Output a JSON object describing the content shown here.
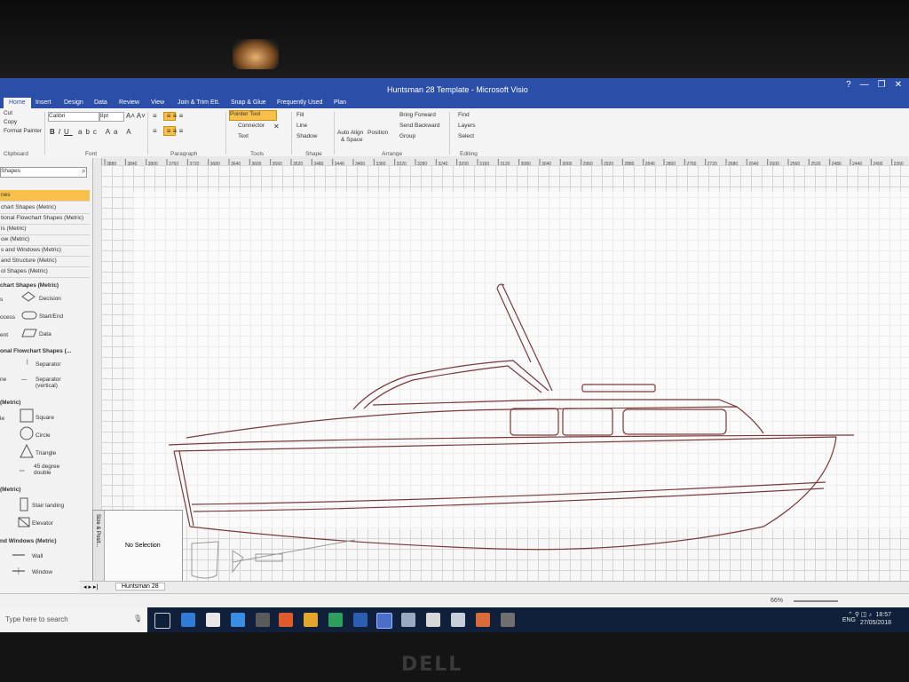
{
  "window": {
    "title": "Huntsman 28 Template - Microsoft Visio"
  },
  "tabs": [
    "Home",
    "Insert",
    "Design",
    "Data",
    "Review",
    "View",
    "Join & Trim Ett.",
    "Snap & Glue",
    "Frequently Used",
    "Plan"
  ],
  "ribbon": {
    "clipboard": {
      "cut": "Cut",
      "copy": "Copy",
      "format_painter": "Format Painter",
      "group": "Clipboard"
    },
    "font": {
      "name": "Calibri",
      "size": "8pt",
      "group": "Font"
    },
    "paragraph": {
      "group": "Paragraph"
    },
    "tools": {
      "pointer": "Pointer Tool",
      "connector": "Connector",
      "text": "Text",
      "group": "Tools"
    },
    "shape": {
      "fill": "Fill",
      "line": "Line",
      "shadow": "Shadow",
      "group": "Shape"
    },
    "arrange": {
      "auto_align": "Auto Align",
      "space": "& Space",
      "position": "Position",
      "bring_forward": "Bring Forward",
      "send_backward": "Send Backward",
      "group_btn": "Group",
      "group": "Arrange"
    },
    "editing": {
      "find": "Find",
      "layers": "Layers",
      "select": "Select",
      "group": "Editing"
    }
  },
  "shapes_panel": {
    "search": "Shapes",
    "stencil_header": "nes",
    "stencils": [
      "chart Shapes (Metric)",
      "tional Flowchart Shapes (Metric)",
      "ls (Metric)",
      "ow (Metric)",
      "s and Windows (Metric)",
      "and Structure (Metric)",
      "ol Shapes (Metric)"
    ],
    "sections": [
      {
        "title": "chart Shapes (Metric)",
        "items": [
          {
            "prefix": "s",
            "name": "Decision"
          },
          {
            "prefix": "ocess",
            "name": "Start/End"
          },
          {
            "prefix": "ent",
            "name": "Data"
          }
        ]
      },
      {
        "title": "onal Flowchart Shapes (...",
        "items": [
          {
            "prefix": "",
            "name": "Separator"
          },
          {
            "prefix": "ne",
            "name": "Separator (vertical)"
          }
        ]
      },
      {
        "title": "(Metric)",
        "items": [
          {
            "prefix": "le",
            "name": "Square"
          },
          {
            "prefix": "",
            "name": "Circle"
          },
          {
            "prefix": "",
            "name": "Triangle"
          },
          {
            "prefix": "",
            "name": "45 degree double"
          }
        ]
      },
      {
        "title": "(Metric)",
        "items": [
          {
            "prefix": "",
            "name": "Stair landing"
          },
          {
            "prefix": "",
            "name": "Elevator"
          }
        ]
      },
      {
        "title": "nd Windows (Metric)",
        "items": [
          {
            "prefix": "",
            "name": "Wall"
          },
          {
            "prefix": "",
            "name": "Window"
          }
        ]
      }
    ]
  },
  "ruler_labels": [
    "3880",
    "3840",
    "3800",
    "3760",
    "3720",
    "3680",
    "3640",
    "3600",
    "3560",
    "3520",
    "3480",
    "3440",
    "3400",
    "3360",
    "3320",
    "3280",
    "3240",
    "3200",
    "3160",
    "3120",
    "3080",
    "3040",
    "3000",
    "2960",
    "2920",
    "2880",
    "2840",
    "2800",
    "2760",
    "2720",
    "2680",
    "2640",
    "2600",
    "2560",
    "2520",
    "2480",
    "2440",
    "2400",
    "2360"
  ],
  "size_panel": {
    "tab": "Size & Posit...",
    "text": "No Selection"
  },
  "page_tab": "Huntsman 28",
  "status": {
    "zoom": "66%"
  },
  "taskbar": {
    "search": "Type here to search",
    "lang": "ENG",
    "time": "18:57",
    "date": "27/05/2018"
  },
  "colors": {
    "accent": "#2b4fa8",
    "highlight": "#f6c04a",
    "taskbar": "#10203a",
    "drawing_line": "#7a3a3a"
  },
  "laptop_brand": "DELL"
}
